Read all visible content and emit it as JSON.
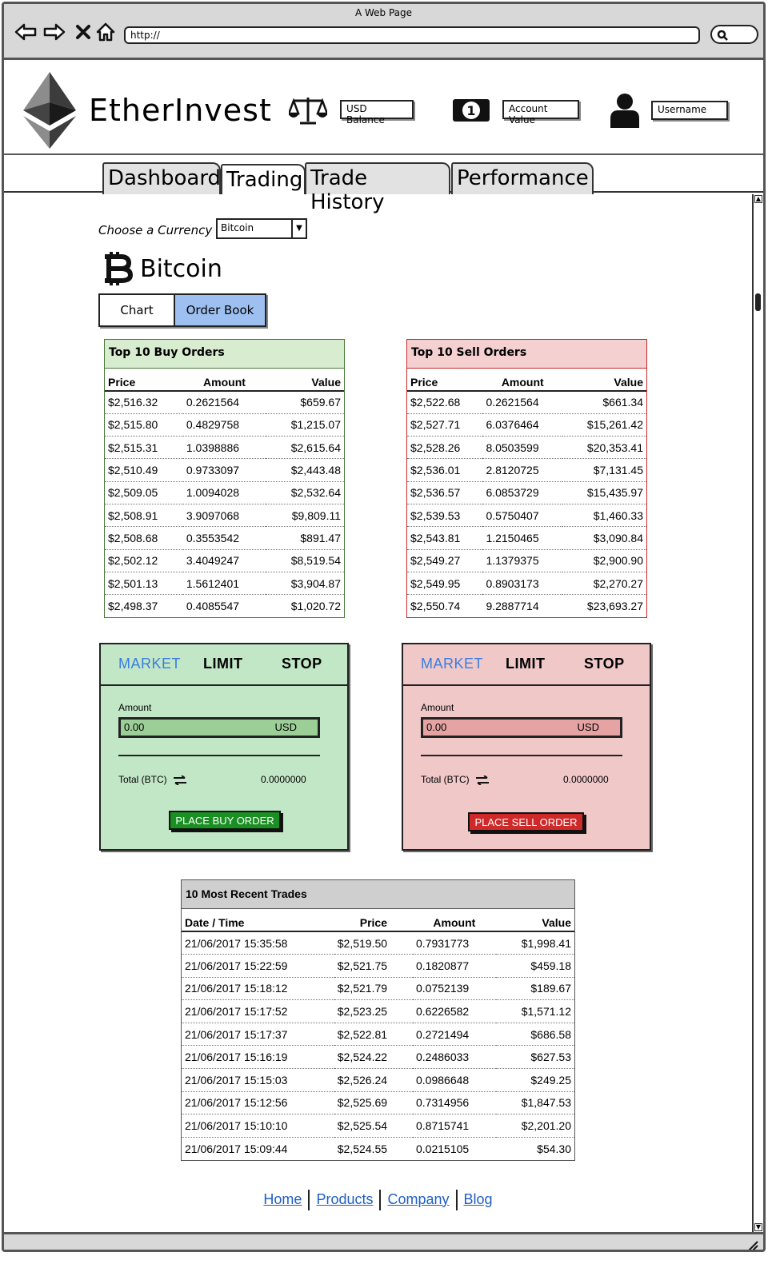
{
  "browser": {
    "window_title": "A Web Page",
    "url": "http://"
  },
  "header": {
    "brand": "EtherInvest",
    "usd_balance": "USD Balance",
    "account_value": "Account Value",
    "username": "Username"
  },
  "tabs": [
    {
      "label": "Dashboard",
      "active": false
    },
    {
      "label": "Trading",
      "active": true
    },
    {
      "label": "Trade History",
      "active": false
    },
    {
      "label": "Performance",
      "active": false
    }
  ],
  "currency": {
    "label": "Choose a Currency",
    "selected": "Bitcoin",
    "title": "Bitcoin"
  },
  "view_toggle": {
    "chart": "Chart",
    "order_book": "Order Book",
    "selected": "Order Book"
  },
  "buy_orders": {
    "title": "Top 10 Buy Orders",
    "columns": [
      "Price",
      "Amount",
      "Value"
    ],
    "rows": [
      [
        "$2,516.32",
        "0.2621564",
        "$659.67"
      ],
      [
        "$2,515.80",
        "0.4829758",
        "$1,215.07"
      ],
      [
        "$2,515.31",
        "1.0398886",
        "$2,615.64"
      ],
      [
        "$2,510.49",
        "0.9733097",
        "$2,443.48"
      ],
      [
        "$2,509.05",
        "1.0094028",
        "$2,532.64"
      ],
      [
        "$2,508.91",
        "3.9097068",
        "$9,809.11"
      ],
      [
        "$2,508.68",
        "0.3553542",
        "$891.47"
      ],
      [
        "$2,502.12",
        "3.4049247",
        "$8,519.54"
      ],
      [
        "$2,501.13",
        "1.5612401",
        "$3,904.87"
      ],
      [
        "$2,498.37",
        "0.4085547",
        "$1,020.72"
      ]
    ]
  },
  "sell_orders": {
    "title": "Top 10 Sell Orders",
    "columns": [
      "Price",
      "Amount",
      "Value"
    ],
    "rows": [
      [
        "$2,522.68",
        "0.2621564",
        "$661.34"
      ],
      [
        "$2,527.71",
        "6.0376464",
        "$15,261.42"
      ],
      [
        "$2,528.26",
        "8.0503599",
        "$20,353.41"
      ],
      [
        "$2,536.01",
        "2.8120725",
        "$7,131.45"
      ],
      [
        "$2,536.57",
        "6.0853729",
        "$15,435.97"
      ],
      [
        "$2,539.53",
        "0.5750407",
        "$1,460.33"
      ],
      [
        "$2,543.81",
        "1.2150465",
        "$3,090.84"
      ],
      [
        "$2,549.27",
        "1.1379375",
        "$2,900.90"
      ],
      [
        "$2,549.95",
        "0.8903173",
        "$2,270.27"
      ],
      [
        "$2,550.74",
        "9.2887714",
        "$23,693.27"
      ]
    ]
  },
  "buy_panel": {
    "tabs": [
      "MARKET",
      "LIMIT",
      "STOP"
    ],
    "amount_label": "Amount",
    "amount_value": "0.00",
    "amount_currency": "USD",
    "total_label": "Total (BTC)",
    "total_value": "0.0000000",
    "button": "PLACE BUY ORDER",
    "color": "#1a8f22"
  },
  "sell_panel": {
    "tabs": [
      "MARKET",
      "LIMIT",
      "STOP"
    ],
    "amount_label": "Amount",
    "amount_value": "0.00",
    "amount_currency": "USD",
    "total_label": "Total (BTC)",
    "total_value": "0.0000000",
    "button": "PLACE SELL ORDER",
    "color": "#cf2a2a"
  },
  "recent_trades": {
    "title": "10 Most Recent Trades",
    "columns": [
      "Date / Time",
      "Price",
      "Amount",
      "Value"
    ],
    "rows": [
      [
        "21/06/2017 15:35:58",
        "$2,519.50",
        "0.7931773",
        "$1,998.41"
      ],
      [
        "21/06/2017 15:22:59",
        "$2,521.75",
        "0.1820877",
        "$459.18"
      ],
      [
        "21/06/2017 15:18:12",
        "$2,521.79",
        "0.0752139",
        "$189.67"
      ],
      [
        "21/06/2017 15:17:52",
        "$2,523.25",
        "0.6226582",
        "$1,571.12"
      ],
      [
        "21/06/2017 15:17:37",
        "$2,522.81",
        "0.2721494",
        "$686.58"
      ],
      [
        "21/06/2017 15:16:19",
        "$2,524.22",
        "0.2486033",
        "$627.53"
      ],
      [
        "21/06/2017 15:15:03",
        "$2,526.24",
        "0.0986648",
        "$249.25"
      ],
      [
        "21/06/2017 15:12:56",
        "$2,525.69",
        "0.7314956",
        "$1,847.53"
      ],
      [
        "21/06/2017 15:10:10",
        "$2,525.54",
        "0.8715741",
        "$2,201.20"
      ],
      [
        "21/06/2017 15:09:44",
        "$2,524.55",
        "0.0215105",
        "$54.30"
      ]
    ]
  },
  "footer": {
    "links": [
      "Home",
      "Products",
      "Company",
      "Blog"
    ]
  },
  "icons": [
    "back-icon",
    "forward-icon",
    "close-icon",
    "home-icon",
    "search-icon",
    "ethereum-logo-icon",
    "scale-icon",
    "banknote-icon",
    "user-icon",
    "bitcoin-icon",
    "swap-icon"
  ],
  "colors": {
    "accent_blue": "#3a7de0",
    "buy_bg": "#c2e7c6",
    "sell_bg": "#f0c8c8",
    "link": "#1f5fc4"
  }
}
